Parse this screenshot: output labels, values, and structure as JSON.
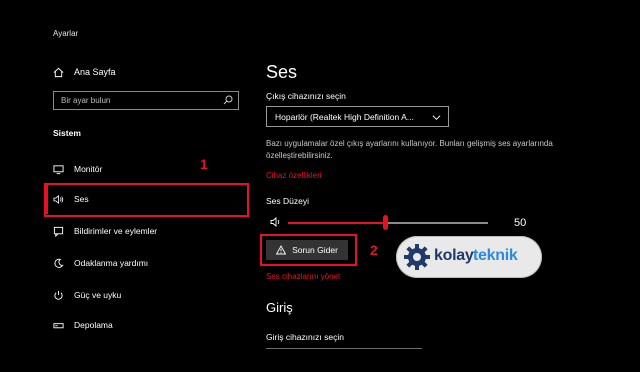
{
  "window": {
    "title": "Ayarlar"
  },
  "sidebar": {
    "home_label": "Ana Sayfa",
    "search_placeholder": "Bir ayar bulun",
    "section_title": "Sistem",
    "items": [
      {
        "label": "Monitör",
        "icon": "monitor-icon"
      },
      {
        "label": "Ses",
        "icon": "speaker-icon",
        "selected": true
      },
      {
        "label": "Bildirimler ve eylemler",
        "icon": "notification-icon"
      },
      {
        "label": "Odaklanma yardımı",
        "icon": "moon-icon"
      },
      {
        "label": "Güç ve uyku",
        "icon": "power-icon"
      },
      {
        "label": "Depolama",
        "icon": "storage-icon"
      }
    ]
  },
  "main": {
    "title": "Ses",
    "output_label": "Çıkış cihazınızı seçin",
    "output_device": "Hoparlör (Realtek High Definition A...",
    "description": "Bazı uygulamalar özel çıkış ayarlarını kullanıyor. Bunları gelişmiş ses ayarlarında özelleştirebilirsiniz.",
    "device_properties_link": "Cihaz özellikleri",
    "volume_label": "Ses Düzeyi",
    "volume_value": "50",
    "volume_level": 50,
    "troubleshoot_button": "Sorun Gider",
    "manage_devices_link": "Ses cihazlarını yönet",
    "input_title": "Giriş",
    "input_label": "Giriş cihazınızı seçin"
  },
  "annotations": {
    "marker_1": "1",
    "marker_2": "2"
  },
  "watermark": {
    "part1": "kolay",
    "part2": "teknik"
  },
  "colors": {
    "accent": "#e81123",
    "background": "#000000",
    "button": "#333333"
  }
}
